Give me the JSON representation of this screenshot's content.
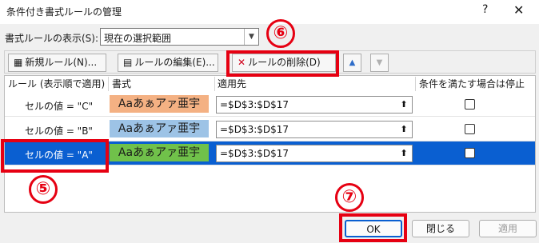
{
  "window": {
    "title": "条件付き書式ルールの管理",
    "help": "?",
    "close": "✕"
  },
  "show": {
    "label": "書式ルールの表示(S):",
    "value": "現在の選択範囲"
  },
  "toolbar": {
    "new_label": "新規ルール(N)...",
    "edit_label": "ルールの編集(E)...",
    "delete_label": "ルールの削除(D)",
    "up_icon": "▲",
    "down_icon": "▼"
  },
  "columns": {
    "rule": "ルール (表示順で適用)",
    "format": "書式",
    "applies": "適用先",
    "stop": "条件を満たす場合は停止"
  },
  "rows": [
    {
      "rule": "セルの値 = \"C\"",
      "format": "Aaあぁアァ亜宇",
      "format_color": "#f4b183",
      "applies": "=$D$3:$D$17",
      "stop": false
    },
    {
      "rule": "セルの値 = \"B\"",
      "format": "Aaあぁアァ亜宇",
      "format_color": "#9dc3e6",
      "applies": "=$D$3:$D$17",
      "stop": false
    },
    {
      "rule": "セルの値 = \"A\"",
      "format": "Aaあぁアァ亜宇",
      "format_color": "#70c14a",
      "applies": "=$D$3:$D$17",
      "stop": false
    }
  ],
  "buttons": {
    "ok": "OK",
    "close": "閉じる",
    "apply": "適用"
  },
  "callouts": {
    "five": "⑤",
    "six": "⑥",
    "seven": "⑦",
    "color": "#e60012"
  }
}
